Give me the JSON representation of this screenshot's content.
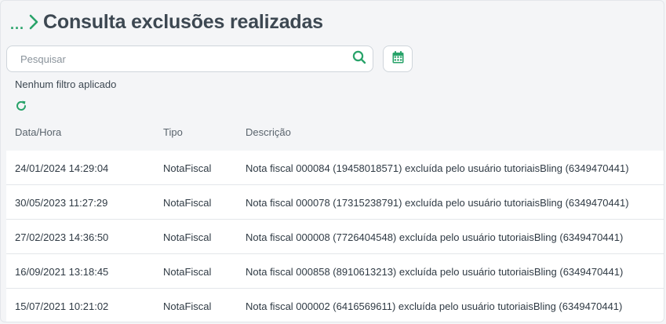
{
  "header": {
    "breadcrumb_ellipsis": "...",
    "title": "Consulta exclusões realizadas"
  },
  "search": {
    "placeholder": "Pesquisar",
    "value": ""
  },
  "filter": {
    "status_text": "Nenhum filtro aplicado"
  },
  "table": {
    "columns": [
      "Data/Hora",
      "Tipo",
      "Descrição"
    ],
    "rows": [
      {
        "datetime": "24/01/2024 14:29:04",
        "type": "NotaFiscal",
        "description": "Nota fiscal 000084 (19458018571) excluída pelo usuário tutoriaisBling (6349470441)"
      },
      {
        "datetime": "30/05/2023 11:27:29",
        "type": "NotaFiscal",
        "description": "Nota fiscal 000078 (17315238791) excluída pelo usuário tutoriaisBling (6349470441)"
      },
      {
        "datetime": "27/02/2023 14:36:50",
        "type": "NotaFiscal",
        "description": "Nota fiscal 000008 (7726404548) excluída pelo usuário tutoriaisBling (6349470441)"
      },
      {
        "datetime": "16/09/2021 13:18:45",
        "type": "NotaFiscal",
        "description": "Nota fiscal 000858 (8910613213) excluída pelo usuário tutoriaisBling (6349470441)"
      },
      {
        "datetime": "15/07/2021 10:21:02",
        "type": "NotaFiscal",
        "description": "Nota fiscal 000002 (6416569611) excluída pelo usuário tutoriaisBling (6349470441)"
      }
    ]
  },
  "icons": {
    "breadcrumb": "chevron-right-icon",
    "search": "search-icon",
    "calendar": "calendar-icon",
    "refresh": "refresh-icon"
  },
  "colors": {
    "accent": "#29a36a",
    "title": "#3d4852",
    "background": "#f4f5f7"
  }
}
